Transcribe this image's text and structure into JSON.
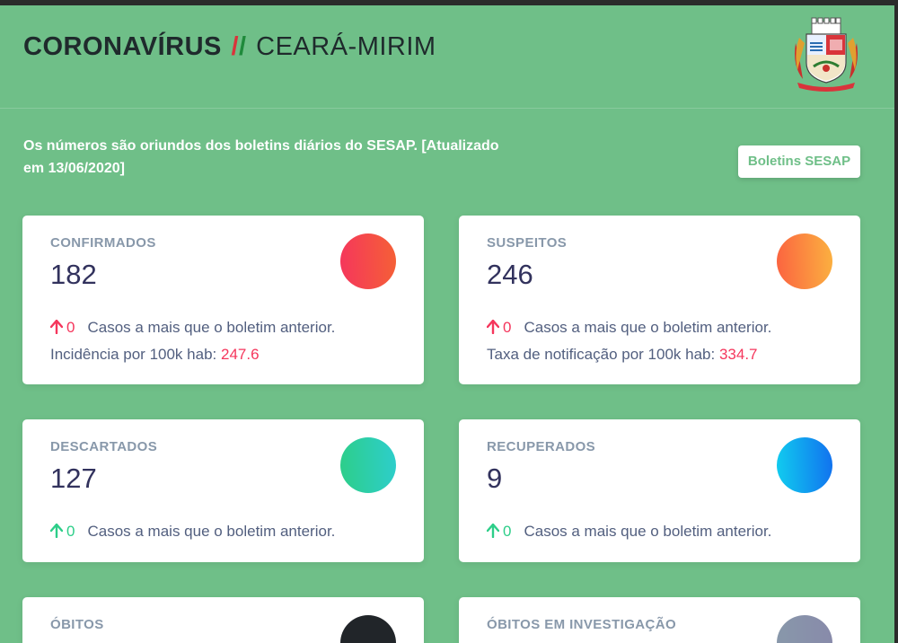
{
  "header": {
    "title_main": "CORONAVÍRUS",
    "title_sep_red": "/",
    "title_sep_green": "/",
    "title_city": "CEARÁ-MIRIM"
  },
  "intro": {
    "line1": "Os números são oriundos dos boletins diários do SESAP. [Atualizado",
    "line2": "em 13/06/2020]"
  },
  "boletins_button": "Boletins SESAP",
  "cards": [
    {
      "label": "CONFIRMADOS",
      "value": "182",
      "delta": "0",
      "delta_text": "Casos a mais que o boletim anterior.",
      "extra_label": "Incidência por 100k hab:",
      "extra_value": "247.6",
      "colors": [
        "#f5365c",
        "#f56036"
      ],
      "arrow_color": "#f5365c"
    },
    {
      "label": "SUSPEITOS",
      "value": "246",
      "delta": "0",
      "delta_text": "Casos a mais que o boletim anterior.",
      "extra_label": "Taxa de notificação por 100k hab:",
      "extra_value": "334.7",
      "colors": [
        "#fb6340",
        "#fbb140"
      ],
      "arrow_color": "#f5365c"
    },
    {
      "label": "DESCARTADOS",
      "value": "127",
      "delta": "0",
      "delta_text": "Casos a mais que o boletim anterior.",
      "colors": [
        "#2dce89",
        "#2dcecc"
      ],
      "arrow_color": "#2dce89"
    },
    {
      "label": "RECUPERADOS",
      "value": "9",
      "delta": "0",
      "delta_text": "Casos a mais que o boletim anterior.",
      "colors": [
        "#11cdef",
        "#1171ef"
      ],
      "arrow_color": "#2dce89"
    },
    {
      "label": "ÓBITOS",
      "colors": [
        "#212529",
        "#212529"
      ]
    },
    {
      "label": "ÓBITOS EM INVESTIGAÇÃO",
      "colors": [
        "#8898aa",
        "#888aaa"
      ]
    }
  ]
}
